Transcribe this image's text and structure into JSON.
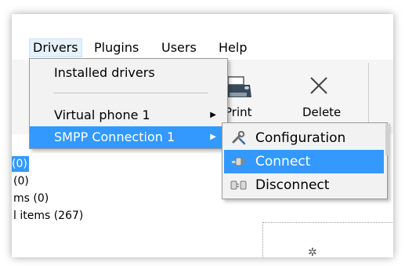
{
  "menubar": {
    "items": [
      "Drivers",
      "Plugins",
      "Users",
      "Help"
    ]
  },
  "toolbar": {
    "print_label": "Print",
    "delete_label": "Delete"
  },
  "drivers_menu": {
    "items": [
      {
        "label": "Installed drivers",
        "has_submenu": false
      },
      {
        "label": "Virtual phone 1",
        "has_submenu": true
      },
      {
        "label": "SMPP Connection 1",
        "has_submenu": true,
        "highlighted": true
      }
    ],
    "arrow": "▶"
  },
  "smpp_submenu": {
    "items": [
      {
        "label": "Configuration",
        "icon": "wrench-icon"
      },
      {
        "label": "Connect",
        "icon": "plug-connect-icon",
        "highlighted": true
      },
      {
        "label": "Disconnect",
        "icon": "plug-disconnect-icon"
      }
    ]
  },
  "tree": {
    "rows": [
      "(0)",
      "(0)",
      "ms (0)",
      "l items (267)"
    ]
  },
  "colors": {
    "highlight": "#3399ff",
    "menu_bg": "#f2f2f2"
  }
}
